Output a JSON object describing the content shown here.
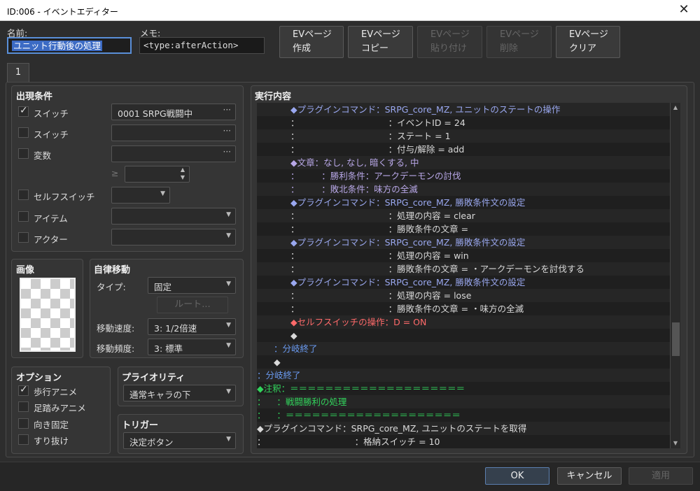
{
  "window": {
    "title": "ID:006 - イベントエディター",
    "close": "✕"
  },
  "header": {
    "name_label": "名前:",
    "name_value": "ユニット行動後の処理",
    "memo_label": "メモ:",
    "memo_value": "<type:afterAction>"
  },
  "page_buttons": [
    {
      "line1": "EVページ",
      "line2": "作成"
    },
    {
      "line1": "EVページ",
      "line2": "コピー"
    },
    {
      "line1": "EVページ",
      "line2": "貼り付け"
    },
    {
      "line1": "EVページ",
      "line2": "削除"
    },
    {
      "line1": "EVページ",
      "line2": "クリア"
    }
  ],
  "tab": {
    "label": "1"
  },
  "conditions": {
    "title": "出現条件",
    "switch1_label": "スイッチ",
    "switch1_value": "0001 SRPG戦闘中",
    "switch1_checked": true,
    "switch2_label": "スイッチ",
    "variable_label": "変数",
    "ge": "≥",
    "selfswitch_label": "セルフスイッチ",
    "item_label": "アイテム",
    "actor_label": "アクター"
  },
  "image": {
    "title": "画像"
  },
  "autonomous": {
    "title": "自律移動",
    "type_label": "タイプ:",
    "type_value": "固定",
    "route_button": "ルート...",
    "speed_label": "移動速度:",
    "speed_value": "3: 1/2倍速",
    "freq_label": "移動頻度:",
    "freq_value": "3: 標準"
  },
  "options": {
    "title": "オプション",
    "walk": "歩行アニメ",
    "step": "足踏みアニメ",
    "dirfix": "向き固定",
    "through": "すり抜け"
  },
  "priority": {
    "title": "プライオリティ",
    "value": "通常キャラの下"
  },
  "trigger": {
    "title": "トリガー",
    "value": "決定ボタン"
  },
  "contents": {
    "title": "実行内容",
    "lines": [
      {
        "p": "      ",
        "t": "◆プラグインコマンド：SRPG_core_MZ, ユニットのステートの操作",
        "c": "c-plug"
      },
      {
        "p": "      ",
        "t": "：                                ：イベントID = 24",
        "c": "c-cmd"
      },
      {
        "p": "      ",
        "t": "：                                ：ステート = 1",
        "c": "c-cmd"
      },
      {
        "p": "      ",
        "t": "：                                ：付与/解除 = add",
        "c": "c-cmd"
      },
      {
        "p": "      ",
        "t": "◆文章：なし, なし, 暗くする, 中",
        "c": "c-txt"
      },
      {
        "p": "      ",
        "t": "：        ：勝利条件：アークデーモンの討伐",
        "c": "c-txt"
      },
      {
        "p": "      ",
        "t": "：        ：敗北条件：味方の全滅",
        "c": "c-txt"
      },
      {
        "p": "      ",
        "t": "◆プラグインコマンド：SRPG_core_MZ, 勝敗条件文の設定",
        "c": "c-plug"
      },
      {
        "p": "      ",
        "t": "：                                ：処理の内容 = clear",
        "c": "c-cmd"
      },
      {
        "p": "      ",
        "t": "：                                ：勝敗条件の文章 =",
        "c": "c-cmd"
      },
      {
        "p": "      ",
        "t": "◆プラグインコマンド：SRPG_core_MZ, 勝敗条件文の設定",
        "c": "c-plug"
      },
      {
        "p": "      ",
        "t": "：                                ：処理の内容 = win",
        "c": "c-cmd"
      },
      {
        "p": "      ",
        "t": "：                                ：勝敗条件の文章 = ・アークデーモンを討伐する",
        "c": "c-cmd"
      },
      {
        "p": "      ",
        "t": "◆プラグインコマンド：SRPG_core_MZ, 勝敗条件文の設定",
        "c": "c-plug"
      },
      {
        "p": "      ",
        "t": "：                                ：処理の内容 = lose",
        "c": "c-cmd"
      },
      {
        "p": "      ",
        "t": "：                                ：勝敗条件の文章 = ・味方の全滅",
        "c": "c-cmd"
      },
      {
        "p": "      ",
        "t": "◆セルフスイッチの操作：D = ON",
        "c": "c-self"
      },
      {
        "p": "      ",
        "t": "◆",
        "c": "c-cmd"
      },
      {
        "p": "   ",
        "t": "：分岐終了",
        "c": "c-br"
      },
      {
        "p": "   ",
        "t": "◆",
        "c": "c-cmd"
      },
      {
        "p": "",
        "t": "：分岐終了",
        "c": "c-br"
      },
      {
        "p": "",
        "t": "◆注釈：＝＝＝＝＝＝＝＝＝＝＝＝＝＝＝＝＝＝＝＝",
        "c": "c-cmt"
      },
      {
        "p": "",
        "t": "：    ：戦闘勝利の処理",
        "c": "c-cmt"
      },
      {
        "p": "",
        "t": "：    ：＝＝＝＝＝＝＝＝＝＝＝＝＝＝＝＝＝＝＝＝",
        "c": "c-cmt"
      },
      {
        "p": "",
        "t": "◆プラグインコマンド：SRPG_core_MZ, ユニットのステートを取得",
        "c": "c-cmd"
      },
      {
        "p": "",
        "t": "：                                ：格納スイッチ = 10",
        "c": "c-cmd"
      }
    ]
  },
  "footer": {
    "ok": "OK",
    "cancel": "キャンセル",
    "apply": "適用"
  }
}
